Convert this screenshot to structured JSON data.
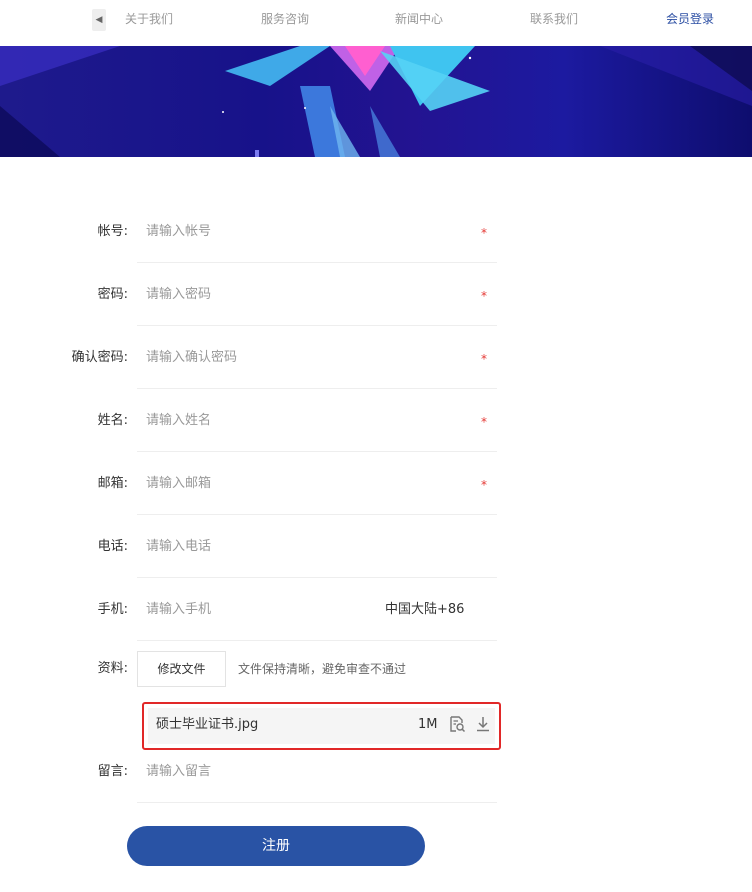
{
  "nav": {
    "items": [
      {
        "label": "关于我们"
      },
      {
        "label": "服务咨询"
      },
      {
        "label": "新闻中心"
      },
      {
        "label": "联系我们"
      },
      {
        "label": "会员登录"
      }
    ]
  },
  "form": {
    "fields": [
      {
        "label": "帐号:",
        "placeholder": "请输入帐号",
        "required": true
      },
      {
        "label": "密码:",
        "placeholder": "请输入密码",
        "required": true
      },
      {
        "label": "确认密码:",
        "placeholder": "请输入确认密码",
        "required": true
      },
      {
        "label": "姓名:",
        "placeholder": "请输入姓名",
        "required": true
      },
      {
        "label": "邮箱:",
        "placeholder": "请输入邮箱",
        "required": true
      },
      {
        "label": "电话:",
        "placeholder": "请输入电话",
        "required": false
      },
      {
        "label": "手机:",
        "placeholder": "请输入手机",
        "required": false,
        "suffix": "中国大陆+86"
      }
    ],
    "upload": {
      "label": "资料:",
      "button_label": "修改文件",
      "hint": "文件保持清晰，避免审查不通过",
      "file": {
        "name": "硕士毕业证书.jpg",
        "size": "1M"
      }
    },
    "message": {
      "label": "留言:",
      "placeholder": "请输入留言"
    },
    "required_mark": "*",
    "submit_label": "注册"
  },
  "colors": {
    "accent": "#2953a5",
    "required": "#e53935",
    "highlight_border": "#e12828"
  }
}
